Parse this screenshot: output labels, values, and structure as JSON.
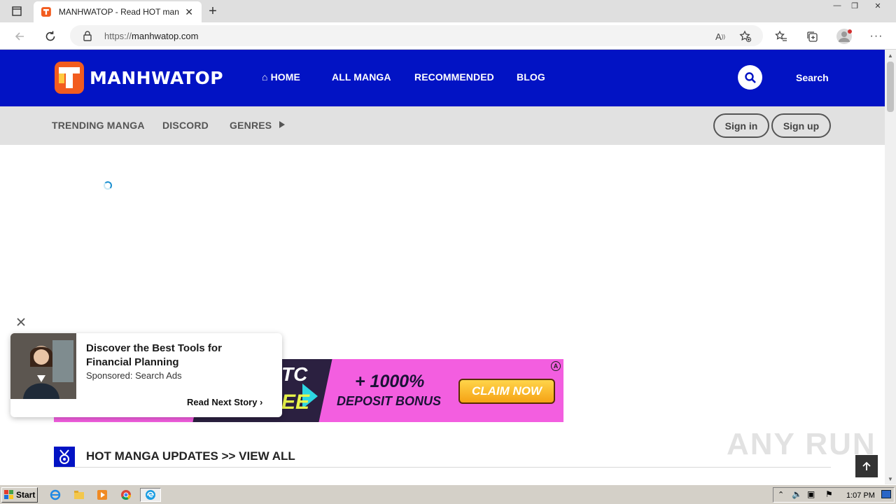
{
  "browser": {
    "tab_title": "MANHWATOP - Read HOT manga",
    "url_scheme": "https://",
    "url_host": "manhwatop.com"
  },
  "site": {
    "logo_text": "MANHWATOP",
    "nav": {
      "home": "HOME",
      "all_manga": "ALL MANGA",
      "recommended": "RECOMMENDED",
      "blog": "BLOG"
    },
    "search_label": "Search",
    "subnav": {
      "trending": "TRENDING MANGA",
      "discord": "DISCORD",
      "genres": "GENRES"
    },
    "sign_in": "Sign in",
    "sign_up": "Sign up",
    "brand_color": "#0213c4"
  },
  "banner_ad": {
    "line1": "TC",
    "line2": "EE",
    "bonus": "+ 1000%",
    "deposit": "DEPOSIT BONUS",
    "cta": "CLAIM NOW",
    "adchoice": "A"
  },
  "popup_ad": {
    "headline": "Discover the Best Tools for Financial Planning",
    "sponsor": "Sponsored: Search Ads",
    "cta": "Read Next Story"
  },
  "section": {
    "title": "HOT MANGA UPDATES >> VIEW ALL"
  },
  "watermark": "ANY RUN",
  "taskbar": {
    "start": "Start",
    "clock": "1:07 PM"
  }
}
